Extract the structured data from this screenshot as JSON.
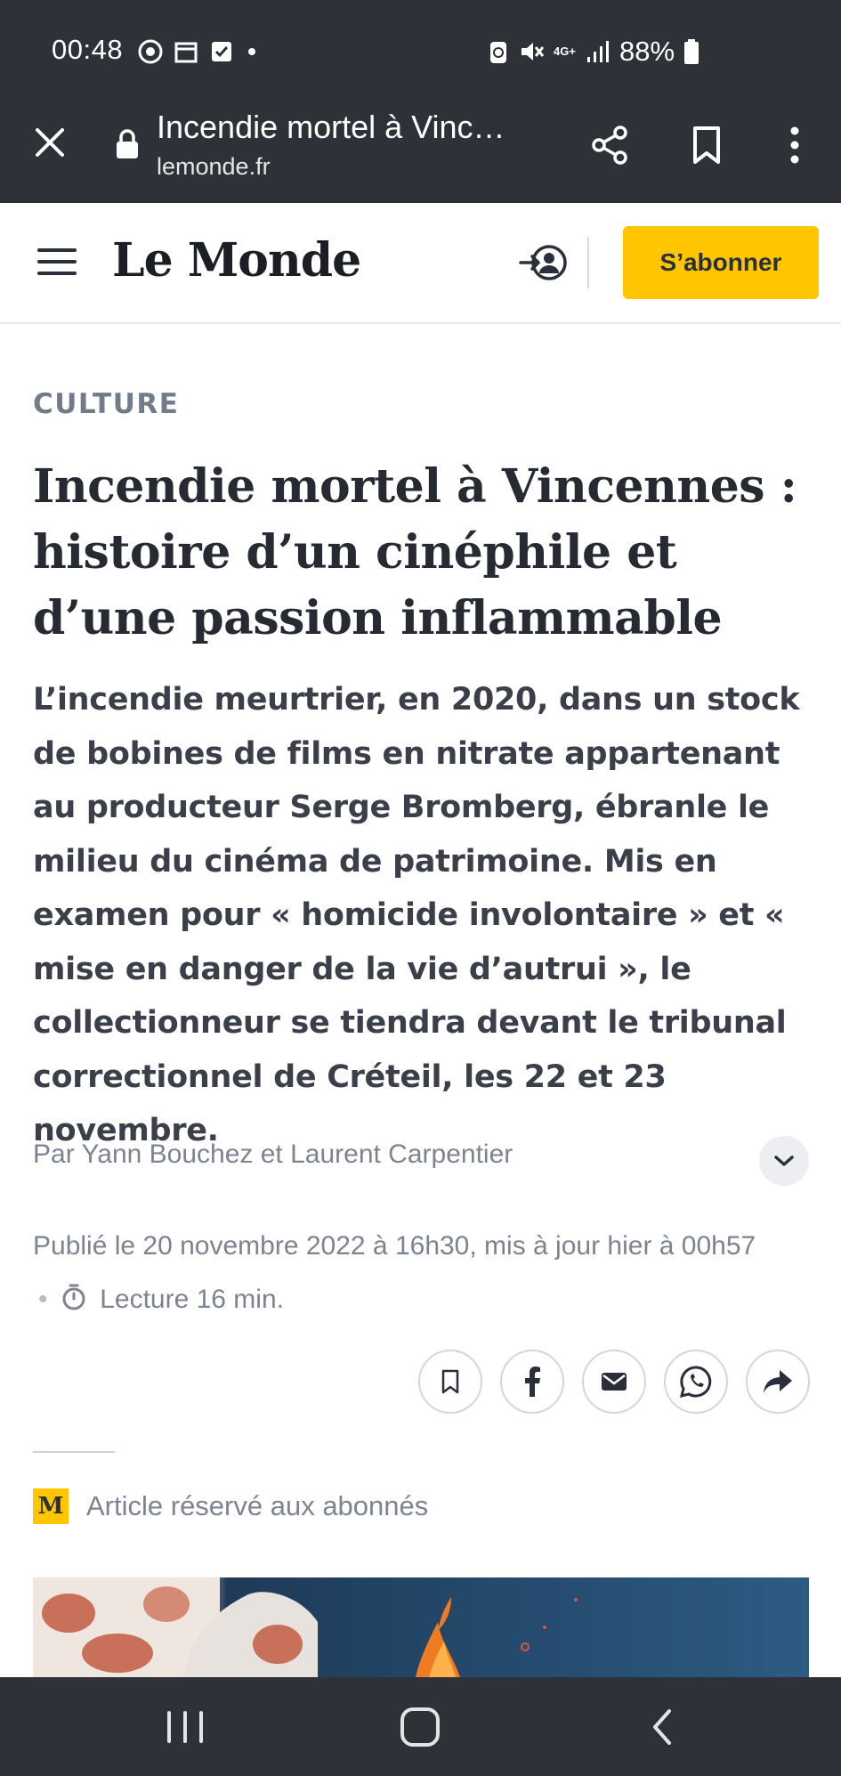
{
  "status_bar": {
    "time": "00:48",
    "network": "4G+",
    "battery": "88%",
    "icons_left": [
      "chrome-icon",
      "calendar-icon",
      "checkbox-icon",
      "dot-icon"
    ],
    "icons_right": [
      "recycle-icon",
      "mute-icon",
      "network-4g-icon",
      "signal-icon",
      "battery-icon"
    ]
  },
  "browser": {
    "page_title": "Incendie mortel à Vinc…",
    "domain": "lemonde.fr"
  },
  "site_header": {
    "logo": "Le Monde",
    "subscribe_label": "S’abonner"
  },
  "article": {
    "rubric": "CULTURE",
    "headline": "Incendie mortel à Vincennes : histoire d’un cinéphile et d’une passion inflammable",
    "standfirst": "L’incendie meurtrier, en 2020, dans un stock de bobines de films en nitrate appartenant au producteur Serge Bromberg, ébranle le milieu du cinéma de patrimoine. Mis en examen pour « homicide involontaire » et « mise en danger de la vie d’autrui », le collectionneur se tiendra devant le tribunal correctionnel de Créteil, les 22 et 23 novembre.",
    "byline": "Par Yann Bouchez et Laurent Carpentier",
    "published": "Publié le 20 novembre 2022 à 16h30, mis à jour hier à 00h57",
    "separator": "•",
    "reading_time": "Lecture 16 min.",
    "premium_badge": "M",
    "premium_label": "Article réservé aux abonnés"
  },
  "colors": {
    "system_bar": "#2e3138",
    "accent_yellow": "#ffc600",
    "text_dark": "#252a33",
    "text_muted": "#7c8491"
  }
}
